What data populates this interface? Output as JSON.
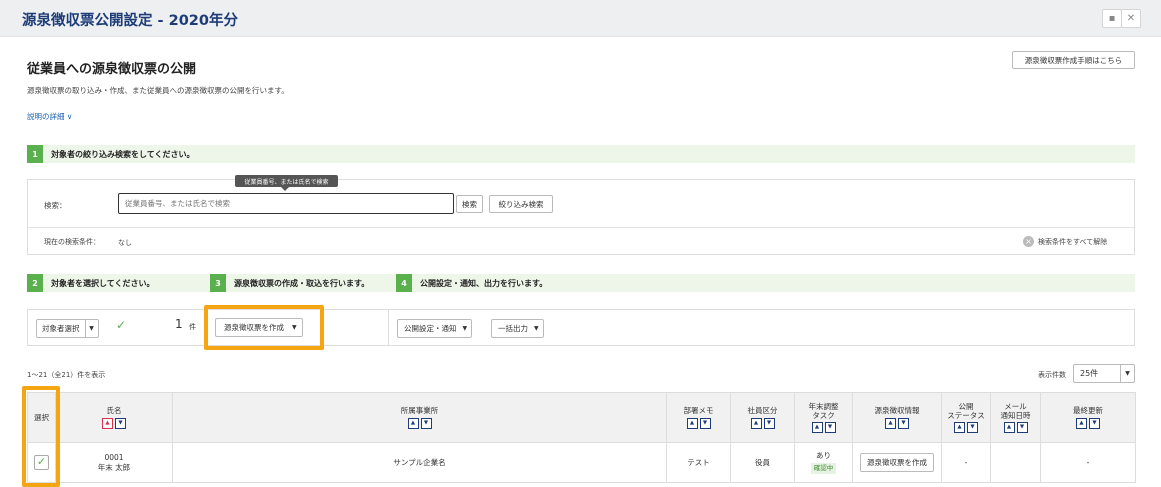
{
  "page": {
    "title": "源泉徴収票公開設定 - 2020年分"
  },
  "topbar": {
    "icons": [
      "comment-icon",
      "close-icon"
    ]
  },
  "section": {
    "title": "従業員への源泉徴収票の公開",
    "description": "源泉徴収票の取り込み・作成、また従業員への源泉徴収票の公開を行います。",
    "detail_link": "説明の詳細",
    "howto_button": "源泉徴収票作成手順はこちら"
  },
  "steps": [
    {
      "num": "1",
      "label": "対象者の絞り込み検索をしてください。"
    },
    {
      "num": "2",
      "label": "対象者を選択してください。"
    },
    {
      "num": "3",
      "label": "源泉徴収票の作成・取込を行います。"
    },
    {
      "num": "4",
      "label": "公開設定・通知、出力を行います。"
    }
  ],
  "search": {
    "label": "検索：",
    "placeholder": "従業員番号、または氏名で検索",
    "tooltip": "従業員番号、または氏名で検索",
    "search_button": "検索",
    "filter_button": "絞り込み検索",
    "condition_label": "現在の検索条件：",
    "condition_value": "なし",
    "clear_all": "検索条件をすべて解除"
  },
  "actions": {
    "select_target": "対象者選択",
    "selected_count": "1",
    "count_unit": "件",
    "create_button": "源泉徴収票を作成",
    "publish_button": "公開設定・通知",
    "bulk_output": "一括出力"
  },
  "list": {
    "range_text": "1〜21（全21）件を表示",
    "per_page_label": "表示件数",
    "per_page_value": "25件"
  },
  "table": {
    "headers": {
      "select": "選択",
      "name": "氏名",
      "office": "所属事業所",
      "memo": "部署メモ",
      "category": "社員区分",
      "task_line1": "年末調整",
      "task_line2": "タスク",
      "info": "源泉徴収情報",
      "status_line1": "公開",
      "status_line2": "ステータス",
      "mail_line1": "メール",
      "mail_line2": "通知日時",
      "updated": "最終更新"
    },
    "rows": [
      {
        "id": "0001",
        "name": "年末 太郎",
        "office": "サンプル企業名",
        "memo": "テスト",
        "category": "役員",
        "task": "あり",
        "task_status": "確認中",
        "action": "源泉徴収票を作成",
        "status": "-",
        "mail": "",
        "updated": "-"
      }
    ]
  },
  "colors": {
    "accent": "#1d3c78",
    "step": "#5ab04c",
    "highlight": "#f5a511",
    "sort_active": "#d9324f"
  }
}
